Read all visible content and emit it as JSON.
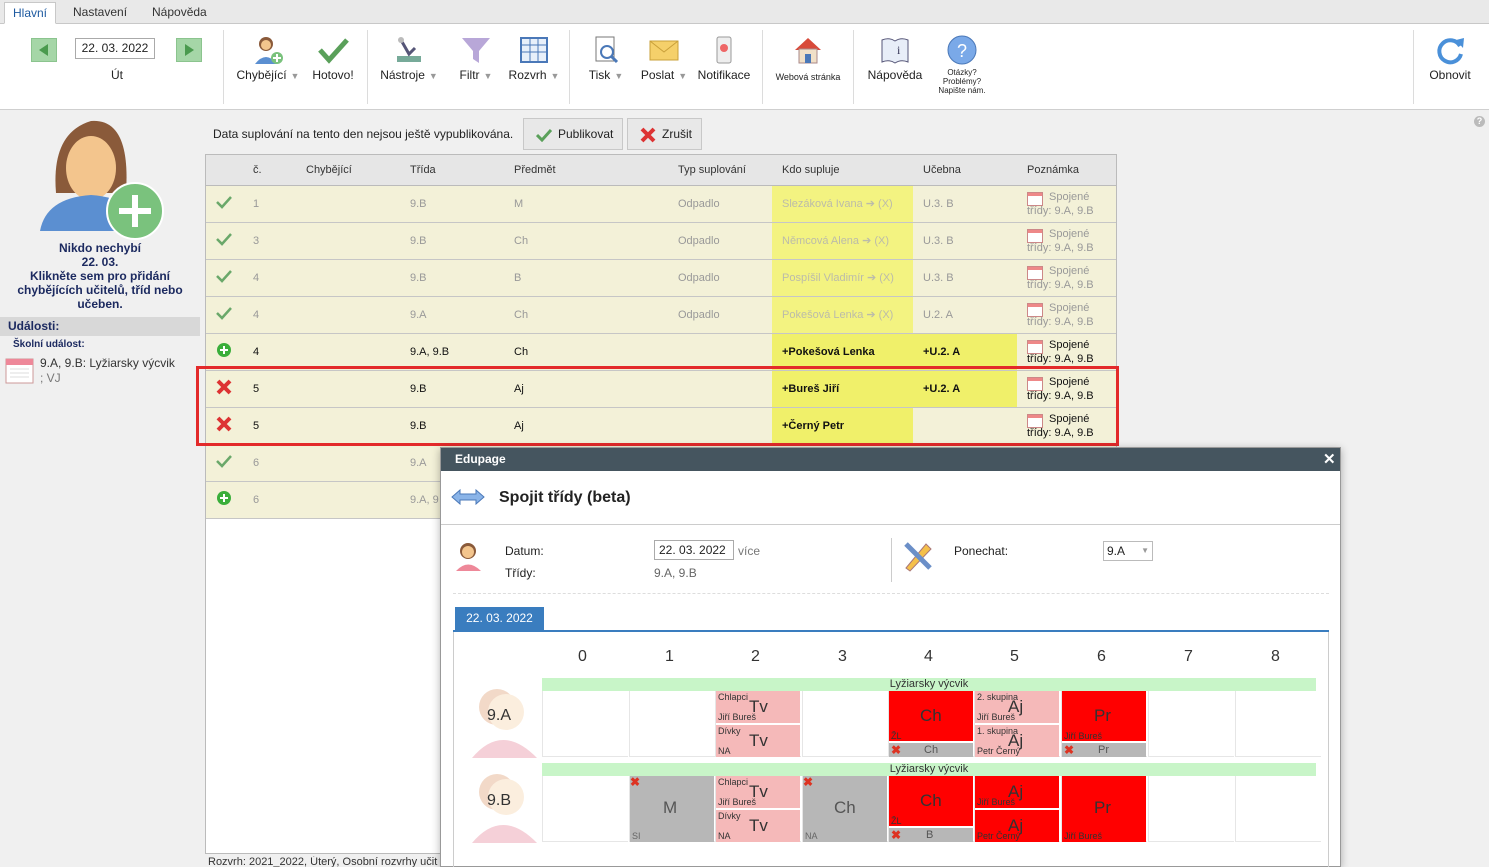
{
  "tabs": [
    "Hlavní",
    "Nastavení",
    "Nápověda"
  ],
  "toolbar": {
    "date": "22. 03. 2022",
    "day": "Út",
    "chybejici": "Chybějící",
    "hotovo": "Hotovo!",
    "nastroje": "Nástroje",
    "filtr": "Filtr",
    "rozvrh": "Rozvrh",
    "tisk": "Tisk",
    "poslat": "Poslat",
    "notifikace": "Notifikace",
    "webova": "Webová stránka",
    "napoveda": "Nápověda",
    "otazky": "Otázky?",
    "problemy": "Problémy?",
    "napiste": "Napište nám.",
    "obnovit": "Obnovit"
  },
  "left": {
    "line1": "Nikdo nechybí",
    "line2": "22. 03.",
    "line3": "Klikněte sem pro přidání",
    "line4": "chybějících učitelů, tříd nebo",
    "line5": "učeben.",
    "events": "Události:",
    "school_event": "Školní událost:",
    "event_text": "9.A, 9.B: Lyžiarsky výcvik",
    "event_text2": "; VJ"
  },
  "notice": {
    "text": "Data suplování na tento den nejsou ještě vypublikována.",
    "publish": "Publikovat",
    "cancel": "Zrušit"
  },
  "table": {
    "headers": [
      "č.",
      "Chybějící",
      "Třída",
      "Předmět",
      "Typ suplování",
      "Kdo supluje",
      "Učebna",
      "Poznámka"
    ],
    "rows": [
      {
        "n": "1",
        "trida": "9.B",
        "predmet": "M",
        "typ": "Odpadlo",
        "kdo": "Slezáková Ivana ➔ (X)",
        "ucebna": "U.3. B",
        "p1": "Spojené",
        "p2": "třídy: 9.A, 9.B"
      },
      {
        "n": "3",
        "trida": "9.B",
        "predmet": "Ch",
        "typ": "Odpadlo",
        "kdo": "Němcová Alena ➔ (X)",
        "ucebna": "U.3. B",
        "p1": "Spojené",
        "p2": "třídy: 9.A, 9.B"
      },
      {
        "n": "4",
        "trida": "9.B",
        "predmet": "B",
        "typ": "Odpadlo",
        "kdo": "Pospíšil Vladimír ➔ (X)",
        "ucebna": "U.3. B",
        "p1": "Spojené",
        "p2": "třídy: 9.A, 9.B"
      },
      {
        "n": "4",
        "trida": "9.A",
        "predmet": "Ch",
        "typ": "Odpadlo",
        "kdo": "Pokešová Lenka ➔ (X)",
        "ucebna": "U.2. A",
        "p1": "Spojené",
        "p2": "třídy: 9.A, 9.B"
      },
      {
        "n": "4",
        "trida": "9.A, 9.B",
        "predmet": "Ch",
        "typ": "",
        "kdo": "+Pokešová Lenka",
        "ucebna": "+U.2. A",
        "p1": "Spojené",
        "p2": "třídy: 9.A, 9.B"
      },
      {
        "n": "5",
        "trida": "9.B",
        "predmet": "Aj",
        "typ": "",
        "kdo": "+Bureš Jiří",
        "ucebna": "+U.2. A",
        "p1": "Spojené",
        "p2": "třídy: 9.A, 9.B"
      },
      {
        "n": "5",
        "trida": "9.B",
        "predmet": "Aj",
        "typ": "",
        "kdo": "+Černý Petr",
        "ucebna": "",
        "p1": "Spojené",
        "p2": "třídy: 9.A, 9.B"
      },
      {
        "n": "6",
        "trida": "9.A",
        "predmet": "",
        "typ": "",
        "kdo": "",
        "ucebna": "",
        "p1": "",
        "p2": ""
      },
      {
        "n": "6",
        "trida": "9.A, 9",
        "predmet": "",
        "typ": "",
        "kdo": "",
        "ucebna": "",
        "p1": "",
        "p2": ""
      }
    ],
    "footer": "Rozvrh: 2021_2022, Úterý, Osobní rozvrhy učit"
  },
  "dialog": {
    "title": "Edupage",
    "heading": "Spojit třídy (beta)",
    "datum_label": "Datum:",
    "datum_value": "22. 03. 2022",
    "vice": "více",
    "tridy_label": "Třídy:",
    "tridy_value": "9.A, 9.B",
    "ponechat_label": "Ponechat:",
    "ponechat_value": "9.A",
    "date_tab": "22. 03. 2022",
    "periods": [
      "0",
      "1",
      "2",
      "3",
      "4",
      "5",
      "6",
      "7",
      "8"
    ],
    "event": "Lyžiarsky výcvik",
    "classes": [
      "9.A",
      "9.B"
    ],
    "cells": {
      "a_tv1": "Tv",
      "a_chlapci": "Chlapci",
      "a_bures1": "Jiří Bureš",
      "a_tv2": "Tv",
      "a_divky": "Dívky",
      "a_na1": "NA",
      "a_ch": "Ch",
      "a_zl": "ŽL",
      "a_ch_gray": "Ch",
      "a_aj1": "Aj",
      "a_skup2": "2. skupina",
      "a_bures2": "Jiří Bureš",
      "a_aj2": "Aj",
      "a_skup1": "1. skupina",
      "a_cerny": "Petr Černý",
      "a_pr": "Pr",
      "a_bures3": "Jiří Bureš",
      "a_pr_gray": "Pr",
      "b_m": "M",
      "b_si": "SI",
      "b_tv1": "Tv",
      "b_chlapci": "Chlapci",
      "b_bures1": "Jiří Bureš",
      "b_tv2": "Tv",
      "b_divky": "Dívky",
      "b_na": "NA",
      "b_ch_gray": "Ch",
      "b_na2": "NA",
      "b_ch": "Ch",
      "b_zl": "ŽL",
      "b_b": "B",
      "b_aj1": "Aj",
      "b_bures2": "Jiří Bureš",
      "b_aj2": "Aj",
      "b_cerny": "Petr Černý",
      "b_pr": "Pr",
      "b_bures3": "Jiří Bureš"
    }
  }
}
